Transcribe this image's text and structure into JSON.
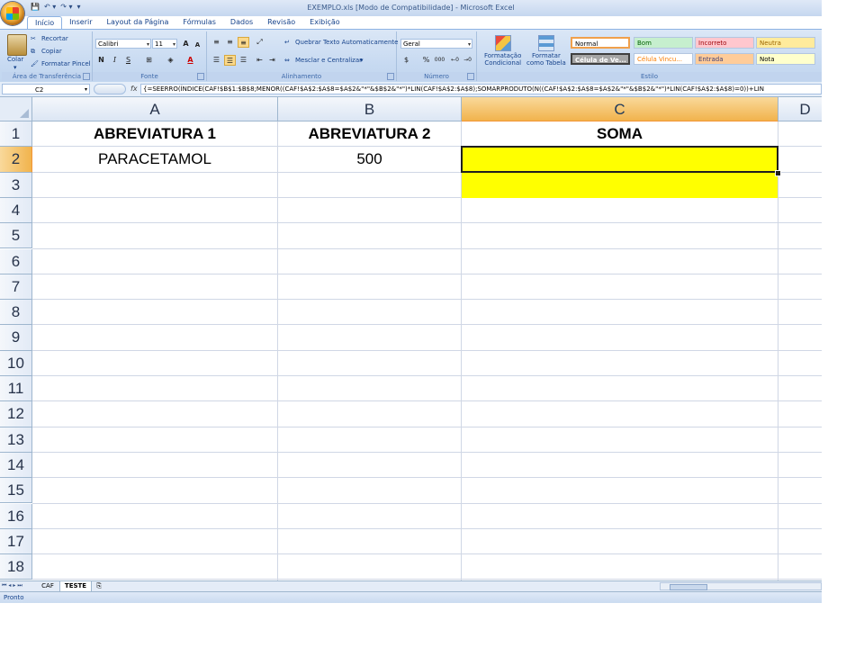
{
  "window": {
    "title": "EXEMPLO.xls  [Modo de Compatibilidade] - Microsoft Excel",
    "qat": [
      "💾",
      "↶ ▾",
      "↷ ▾",
      "▾"
    ]
  },
  "tabs": [
    "Início",
    "Inserir",
    "Layout da Página",
    "Fórmulas",
    "Dados",
    "Revisão",
    "Exibição"
  ],
  "ribbon": {
    "clipboard": {
      "label": "Área de Transferência",
      "paste": "Colar",
      "cut": "Recortar",
      "copy": "Copiar",
      "format_painter": "Formatar Pincel"
    },
    "font": {
      "label": "Fonte",
      "name": "Calibri",
      "size": "11",
      "grow": "A",
      "shrink": "A",
      "bold": "N",
      "italic": "I",
      "underline": "S"
    },
    "alignment": {
      "label": "Alinhamento",
      "wrap": "Quebrar Texto Automaticamente",
      "merge": "Mesclar e Centralizar"
    },
    "number": {
      "label": "Número",
      "format": "Geral",
      "percent": "%",
      "thousands": "000"
    },
    "styles": {
      "label": "Estilo",
      "conditional": [
        "Formatação",
        "Condicional"
      ],
      "as_table": [
        "Formatar",
        "como Tabela"
      ],
      "cells": [
        "Normal",
        "Bom",
        "Incorreto",
        "Neutra",
        "Célula de Ve...",
        "Célula Vincu...",
        "Entrada",
        "Nota"
      ]
    }
  },
  "formula_bar": {
    "name_box": "C2",
    "fx": "fx",
    "formula": "{=SEERRO(ÍNDICE(CAF!$B$1:$B$8;MENOR((CAF!$A$2:$A$8=$A$2&\"*\"&$B$2&\"*\")*LIN(CAF!$A$2:$A$8);SOMARPRODUTO(N((CAF!$A$2:$A$8=$A$2&\"*\"&$B$2&\"*\")*LIN(CAF!$A$2:$A$8)=0))+LIN"
  },
  "grid": {
    "columns": [
      "A",
      "B",
      "C",
      "D"
    ],
    "rows": [
      "1",
      "2",
      "3",
      "4",
      "5",
      "6",
      "7",
      "8",
      "9",
      "10",
      "11",
      "12",
      "13",
      "14",
      "15",
      "16",
      "17",
      "18"
    ],
    "cells": {
      "A1": "ABREVIATURA 1",
      "B1": "ABREVIATURA 2",
      "C1": "SOMA",
      "A2": "PARACETAMOL",
      "B2": "500"
    },
    "highlight_color": "#ffff00"
  },
  "sheets": [
    "CAF",
    "TESTE"
  ],
  "active_sheet": "TESTE",
  "status": "Pronto"
}
